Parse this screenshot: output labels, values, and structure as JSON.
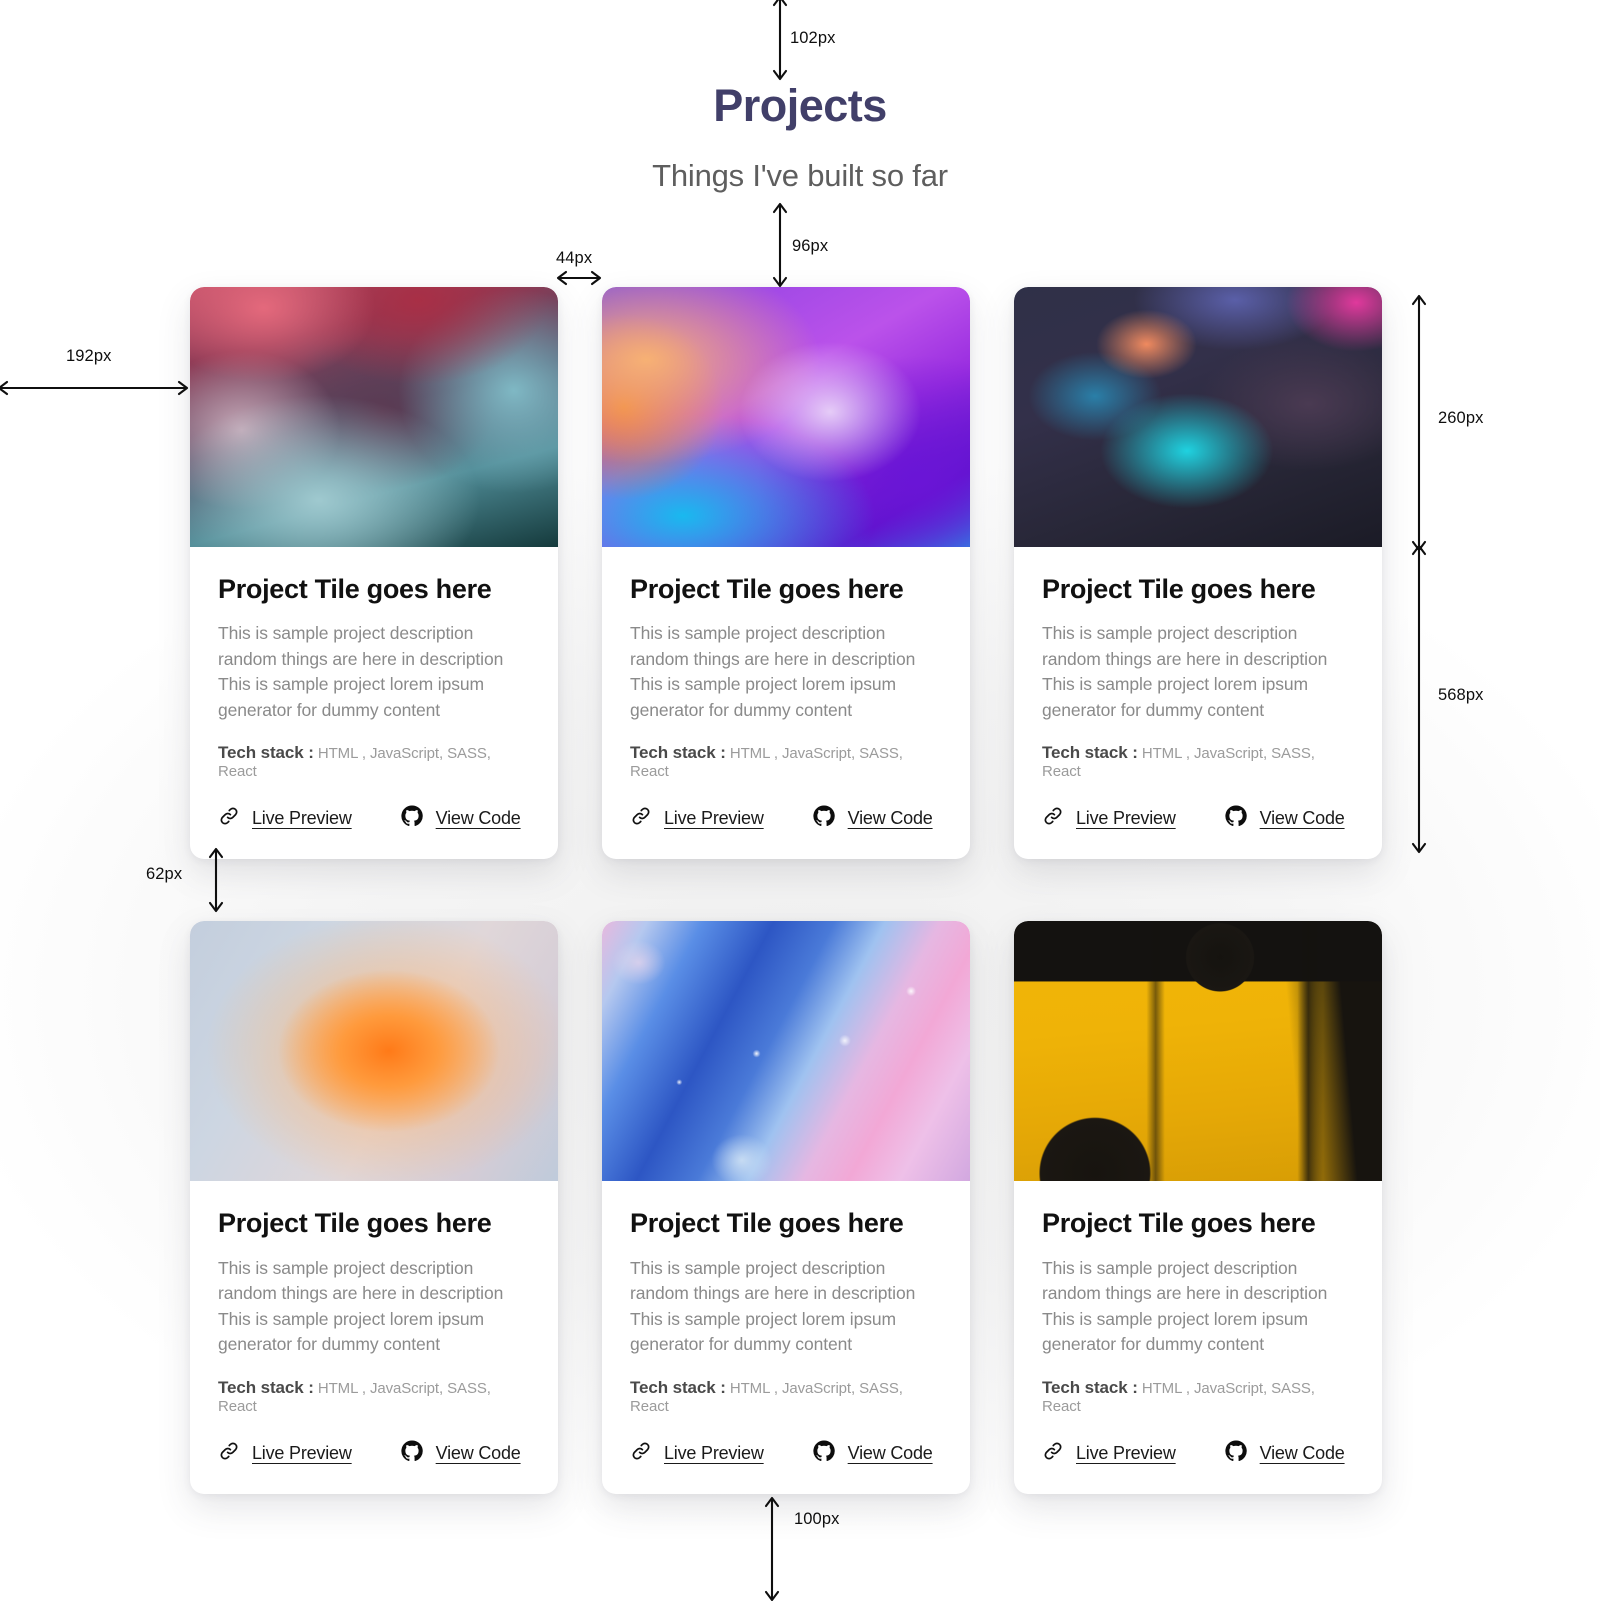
{
  "header": {
    "title": "Projects",
    "subtitle": "Things I've built so far"
  },
  "colors": {
    "title": "#413f69",
    "subtitle": "#5e5e5e",
    "card_title": "#111111",
    "card_description": "#8a8a8a",
    "stack_label": "#4a4a4a",
    "stack_value": "#9b9b9b",
    "link_text": "#1a1a1a",
    "page_background": "#ffffff",
    "card_background": "#ffffff",
    "annotation": "#0f0f0f"
  },
  "card_defaults": {
    "title": "Project Tile goes here",
    "description": "This is sample project description random things are here in description This is sample project lorem ipsum generator for dummy content",
    "stack_label": "Tech stack :",
    "stack_value": "HTML , JavaScript, SASS, React",
    "live_preview_label": "Live Preview",
    "view_code_label": "View Code",
    "live_preview_icon": "link-icon",
    "view_code_icon": "github-icon"
  },
  "cards": [
    {
      "id": "card-1",
      "title": "Project Tile goes here",
      "description": "This is sample project description random things are here in description This is sample project lorem ipsum generator for dummy content",
      "stack_label": "Tech stack :",
      "stack_value": "HTML , JavaScript, SASS, React",
      "live_preview_label": "Live Preview",
      "view_code_label": "View Code",
      "thumbnail": "red-teal-ink-marbling"
    },
    {
      "id": "card-2",
      "title": "Project Tile goes here",
      "description": "This is sample project description random things are here in description This is sample project lorem ipsum generator for dummy content",
      "stack_label": "Tech stack :",
      "stack_value": "HTML , JavaScript, SASS, React",
      "live_preview_label": "Live Preview",
      "view_code_label": "View Code",
      "thumbnail": "purple-orange-cyan-gradient-wave"
    },
    {
      "id": "card-3",
      "title": "Project Tile goes here",
      "description": "This is sample project description random things are here in description This is sample project lorem ipsum generator for dummy content",
      "stack_label": "Tech stack :",
      "stack_value": "HTML , JavaScript, SASS, React",
      "live_preview_label": "Live Preview",
      "view_code_label": "View Code",
      "thumbnail": "dark-blurred-cyan-magenta-bokeh"
    },
    {
      "id": "card-4",
      "title": "Project Tile goes here",
      "description": "This is sample project description random things are here in description This is sample project lorem ipsum generator for dummy content",
      "stack_label": "Tech stack :",
      "stack_value": "HTML , JavaScript, SASS, React",
      "live_preview_label": "Live Preview",
      "view_code_label": "View Code",
      "thumbnail": "soft-orange-radial-glow"
    },
    {
      "id": "card-5",
      "title": "Project Tile goes here",
      "description": "This is sample project description random things are here in description This is sample project lorem ipsum generator for dummy content",
      "stack_label": "Tech stack :",
      "stack_value": "HTML , JavaScript, SASS, React",
      "live_preview_label": "Live Preview",
      "view_code_label": "View Code",
      "thumbnail": "blue-pink-liquid-marble"
    },
    {
      "id": "card-6",
      "title": "Project Tile goes here",
      "description": "This is sample project description random things are here in description This is sample project lorem ipsum generator for dummy content",
      "stack_label": "Tech stack :",
      "stack_value": "HTML , JavaScript, SASS, React",
      "live_preview_label": "Live Preview",
      "view_code_label": "View Code",
      "thumbnail": "yellow-black-grunge-paint"
    }
  ],
  "annotations": [
    {
      "id": "top-spacing",
      "label": "102px"
    },
    {
      "id": "subtitle-to-grid",
      "label": "96px"
    },
    {
      "id": "left-margin",
      "label": "192px"
    },
    {
      "id": "column-gap",
      "label": "44px"
    },
    {
      "id": "thumbnail-height",
      "label": "260px"
    },
    {
      "id": "card-height",
      "label": "568px"
    },
    {
      "id": "row-gap",
      "label": "62px"
    },
    {
      "id": "bottom-spacing",
      "label": "100px"
    }
  ]
}
